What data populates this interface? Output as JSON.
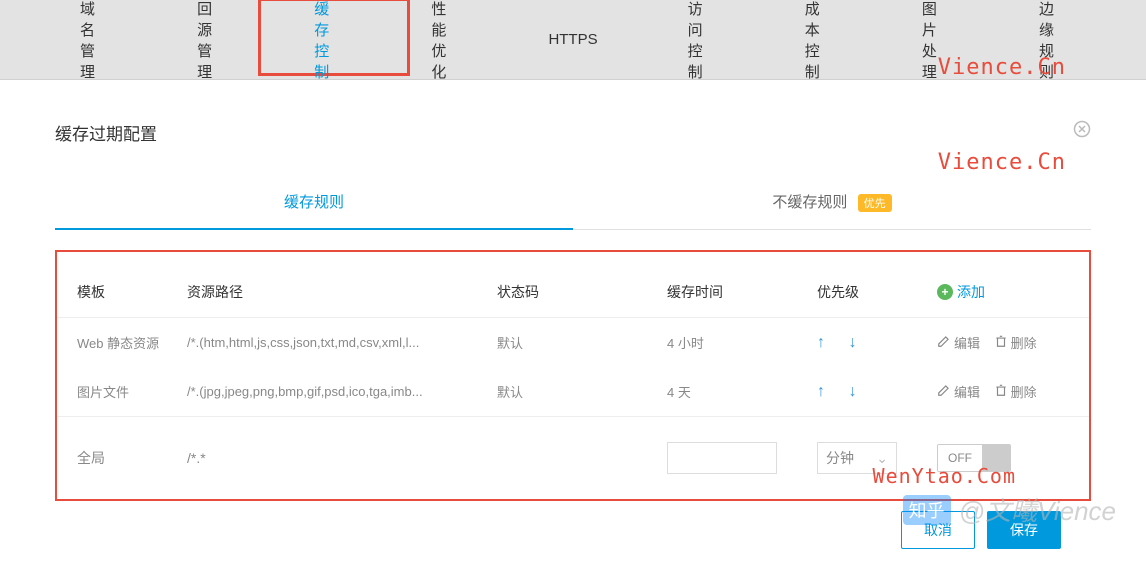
{
  "nav": {
    "items": [
      "域名管理",
      "回源管理",
      "缓存控制",
      "性能优化",
      "HTTPS",
      "访问控制",
      "成本控制",
      "图片处理",
      "边缘规则"
    ],
    "active_index": 2
  },
  "modal": {
    "title": "缓存过期配置",
    "sub_tabs": {
      "cache_rules": "缓存规则",
      "no_cache_rules": "不缓存规则",
      "priority_badge": "优先"
    }
  },
  "table": {
    "headers": {
      "template": "模板",
      "path": "资源路径",
      "status": "状态码",
      "cache_time": "缓存时间",
      "priority": "优先级",
      "add": "添加"
    },
    "rows": [
      {
        "template": "Web 静态资源",
        "path": "/*.(htm,html,js,css,json,txt,md,csv,xml,l...",
        "status": "默认",
        "cache_time": "4 小时"
      },
      {
        "template": "图片文件",
        "path": "/*.(jpg,jpeg,png,bmp,gif,psd,ico,tga,imb...",
        "status": "默认",
        "cache_time": "4 天"
      }
    ],
    "actions": {
      "edit": "编辑",
      "delete": "删除"
    },
    "global": {
      "label": "全局",
      "path": "/*.*",
      "unit": "分钟",
      "toggle": "OFF"
    }
  },
  "buttons": {
    "cancel": "取消",
    "save": "保存"
  },
  "watermarks": {
    "top1": "Vience.Cn",
    "top2": "Vience.Cn",
    "bottom": "WenYtao.Com",
    "zhihu": "@文曦Vience",
    "zhihu_logo": "知乎"
  }
}
